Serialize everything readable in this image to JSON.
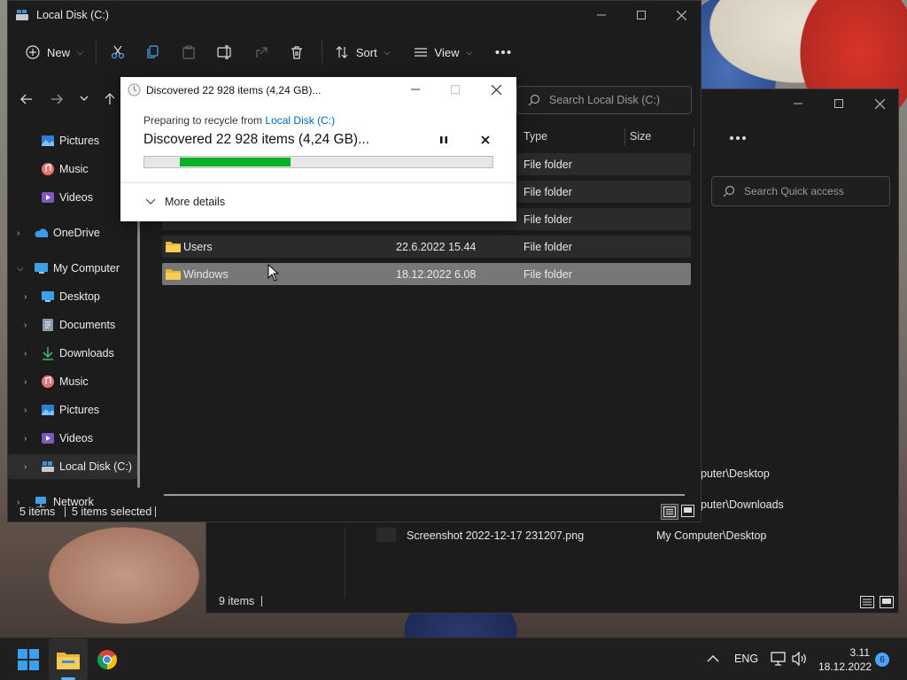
{
  "window_back": {
    "search_placeholder": "Search Quick access",
    "rows": [
      {
        "name": "",
        "location": "puter\\Desktop"
      },
      {
        "name": "",
        "location": "puter\\Downloads"
      },
      {
        "name": "Screenshot 2022-12-17 231207.png",
        "location": "My Computer\\Desktop"
      }
    ],
    "status_count": "9 items"
  },
  "window_main": {
    "title": "Local Disk (C:)",
    "toolbar": {
      "new_label": "New",
      "sort_label": "Sort",
      "view_label": "View"
    },
    "search_placeholder": "Search Local Disk (C:)",
    "columns": {
      "type": "Type",
      "size": "Size"
    },
    "sidebar": {
      "items": [
        {
          "label": "Pictures",
          "icon": "pictures-icon"
        },
        {
          "label": "Music",
          "icon": "music-icon"
        },
        {
          "label": "Videos",
          "icon": "videos-icon"
        },
        {
          "label": "OneDrive",
          "icon": "onedrive-icon"
        },
        {
          "label": "My Computer",
          "icon": "computer-icon"
        },
        {
          "label": "Desktop",
          "icon": "desktop-icon"
        },
        {
          "label": "Documents",
          "icon": "documents-icon"
        },
        {
          "label": "Downloads",
          "icon": "downloads-icon"
        },
        {
          "label": "Music",
          "icon": "music-icon"
        },
        {
          "label": "Pictures",
          "icon": "pictures-icon"
        },
        {
          "label": "Videos",
          "icon": "videos-icon"
        },
        {
          "label": "Local Disk (C:)",
          "icon": "drive-icon"
        },
        {
          "label": "Network",
          "icon": "network-icon"
        }
      ]
    },
    "files": [
      {
        "name": "",
        "date": "",
        "type": "File folder"
      },
      {
        "name": "",
        "date": "",
        "type": "File folder"
      },
      {
        "name": "",
        "date": "",
        "type": "File folder"
      },
      {
        "name": "Users",
        "date": "22.6.2022 15.44",
        "type": "File folder"
      },
      {
        "name": "Windows",
        "date": "18.12.2022 6.08",
        "type": "File folder"
      }
    ],
    "status": {
      "count": "5 items",
      "selected": "5 items selected"
    }
  },
  "dialog": {
    "title": "Discovered 22 928 items (4,24 GB)...",
    "preparing_prefix": "Preparing to recycle from",
    "source_link": "Local Disk (C:)",
    "heading": "Discovered 22 928 items (4,24 GB)...",
    "progress_fraction": 0.32,
    "more_details": "More details"
  },
  "taskbar": {
    "language": "ENG",
    "time": "3.11",
    "date": "18.12.2022",
    "notification_count": "6"
  },
  "colors": {
    "accent": "#0078d4",
    "progress_green": "#06b025",
    "link_blue": "#0067c0",
    "selection_gray": "#777777"
  }
}
